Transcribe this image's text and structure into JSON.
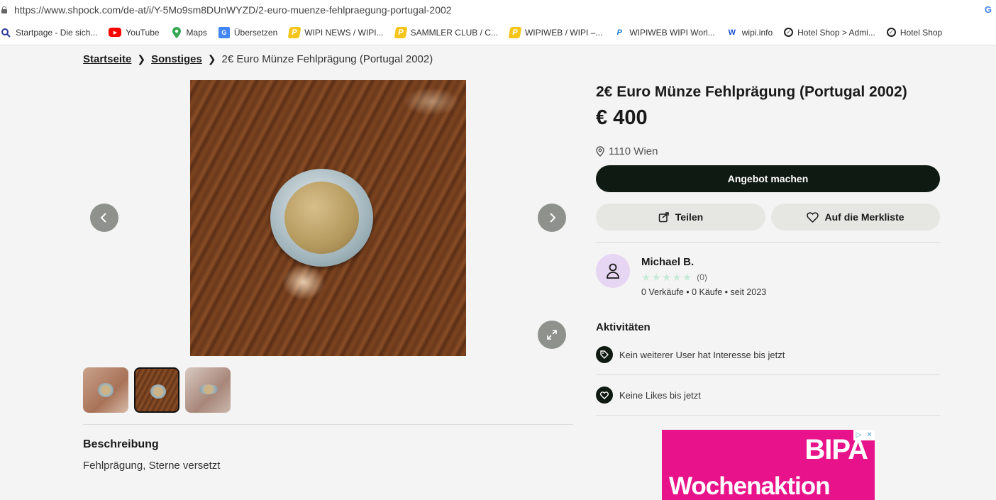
{
  "browser": {
    "url": "https://www.shpock.com/de-at/i/Y-5Mo9sm8DUnWYZD/2-euro-muenze-fehlpraegung-portugal-2002",
    "bookmarks": [
      {
        "label": "Startpage - Die sich...",
        "icon": "startpage-search-icon"
      },
      {
        "label": "YouTube",
        "icon": "youtube-icon"
      },
      {
        "label": "Maps",
        "icon": "maps-pin-icon"
      },
      {
        "label": "Übersetzen",
        "icon": "translate-icon"
      },
      {
        "label": "WIPI NEWS / WIPI...",
        "icon": "wipi-icon"
      },
      {
        "label": "SAMMLER CLUB / C...",
        "icon": "wipi-icon"
      },
      {
        "label": "WIPIWEB / WIPI –...",
        "icon": "wipi-icon"
      },
      {
        "label": "WIPIWEB WIPI Worl...",
        "icon": "wipiweb-icon"
      },
      {
        "label": "wipi.info",
        "icon": "wipi-info-icon"
      },
      {
        "label": "Hotel Shop > Admi...",
        "icon": "hotel-check-icon"
      },
      {
        "label": "Hotel Shop",
        "icon": "hotel-check-icon"
      }
    ]
  },
  "breadcrumb": {
    "home": "Startseite",
    "category": "Sonstiges",
    "current": "2€ Euro Münze Fehlprägung (Portugal 2002)"
  },
  "listing": {
    "title": "2€ Euro Münze Fehlprägung (Portugal 2002)",
    "price": "€ 400",
    "location": "1110 Wien",
    "offer_button": "Angebot machen",
    "share_button": "Teilen",
    "watchlist_button": "Auf die Merkliste"
  },
  "seller": {
    "name": "Michael B.",
    "rating_count": "(0)",
    "stats": "0 Verkäufe • 0 Käufe • seit 2023"
  },
  "activities": {
    "title": "Aktivitäten",
    "items": [
      {
        "text": "Kein weiterer User hat Interesse bis jetzt",
        "icon": "tag-icon"
      },
      {
        "text": "Keine Likes bis jetzt",
        "icon": "heart-icon"
      }
    ]
  },
  "description": {
    "title": "Beschreibung",
    "text": "Fehlprägung, Sterne versetzt"
  },
  "ad": {
    "brand": "BIPA",
    "text": "Wochenaktion",
    "color": "#e8138a"
  },
  "colors": {
    "primary_button": "#0f1b12",
    "secondary_button": "#e6e7e3",
    "avatar_bg": "#e7d6f3",
    "star_empty": "#c8ead8"
  }
}
